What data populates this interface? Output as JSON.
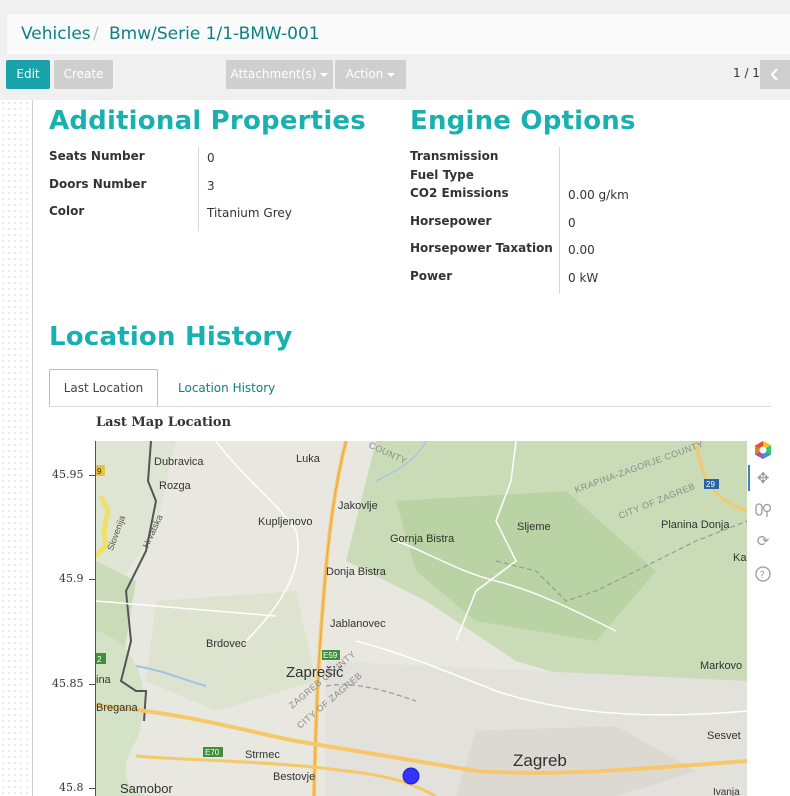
{
  "breadcrumb": {
    "parent": "Vehicles",
    "separator": "/",
    "current": "Bmw/Serie 1/1-BMW-001"
  },
  "toolbar": {
    "edit_label": "Edit",
    "create_label": "Create",
    "attachments_label": "Attachment(s)",
    "action_label": "Action"
  },
  "pager": {
    "text": "1 / 1"
  },
  "additional_properties": {
    "title": "Additional Properties",
    "fields": [
      {
        "label": "Seats Number",
        "value": "0"
      },
      {
        "label": "Doors Number",
        "value": "3"
      },
      {
        "label": "Color",
        "value": "Titanium Grey"
      }
    ]
  },
  "engine_options": {
    "title": "Engine Options",
    "fields": [
      {
        "label": "Transmission",
        "value": ""
      },
      {
        "label": "Fuel Type",
        "value": ""
      },
      {
        "label": "CO2 Emissions",
        "value": "0.00",
        "unit": "g/km"
      },
      {
        "label": "Horsepower",
        "value": "0"
      },
      {
        "label": "Horsepower Taxation",
        "value": "0.00"
      },
      {
        "label": "Power",
        "value": "0",
        "unit": "kW"
      }
    ]
  },
  "location_history": {
    "title": "Location History",
    "tabs": [
      {
        "label": "Last Location",
        "active": true
      },
      {
        "label": "Location History",
        "active": false
      }
    ]
  },
  "map_plot": {
    "title": "Last Map Location",
    "y_ticks": [
      "45.95",
      "45.9",
      "45.85",
      "45.8"
    ],
    "places": [
      "Dubravica",
      "Luka",
      "Rozga",
      "Jakovlje",
      "Kupljenovo",
      "Sljeme",
      "Gornja Bistra",
      "Planina Donja",
      "Donja Bistra",
      "Jablanovec",
      "Brdovec",
      "Zaprešić",
      "Markovo",
      "Bregana",
      "Strmec",
      "Bestovje",
      "Zagreb",
      "Sesvet",
      "Samobor",
      "Slovenija",
      "Hrvatska",
      "KRAPINA-ZAGORJE COUNTY",
      "CITY OF ZAGREB",
      "ZAGREB COUNTY",
      "CITY OF ZAGREB",
      "COUNTY",
      "E59",
      "E70",
      "29",
      "9",
      "2",
      "ina",
      "Ka",
      "Ivanja"
    ],
    "marker_color": "#3333ff"
  },
  "colors": {
    "accent": "#19b0b0",
    "link": "#0d7f86",
    "primary_button": "#17a3a9"
  },
  "map_tools": [
    "bokeh-logo-icon",
    "pan-icon",
    "wheel-zoom-icon",
    "reset-icon",
    "help-icon"
  ]
}
